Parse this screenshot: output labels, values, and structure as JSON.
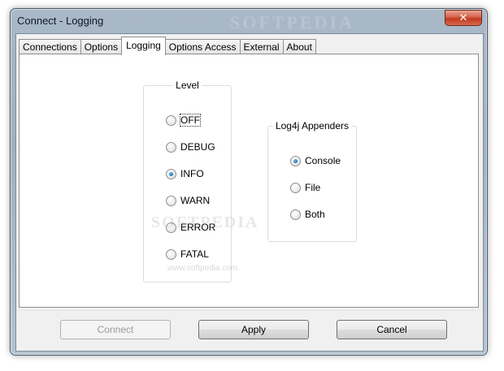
{
  "window": {
    "title": "Connect - Logging",
    "watermark": "SOFTPEDIA",
    "close_glyph": "✕"
  },
  "tabs": [
    {
      "label": "Connections",
      "active": false
    },
    {
      "label": "Options",
      "active": false
    },
    {
      "label": "Logging",
      "active": true
    },
    {
      "label": "Options Access",
      "active": false
    },
    {
      "label": "External",
      "active": false
    },
    {
      "label": "About",
      "active": false
    }
  ],
  "level": {
    "title": "Level",
    "options": [
      {
        "label": "OFF",
        "checked": false
      },
      {
        "label": "DEBUG",
        "checked": false
      },
      {
        "label": "INFO",
        "checked": true
      },
      {
        "label": "WARN",
        "checked": false
      },
      {
        "label": "ERROR",
        "checked": false
      },
      {
        "label": "FATAL",
        "checked": false
      }
    ]
  },
  "appenders": {
    "title": "Log4j Appenders",
    "options": [
      {
        "label": "Console",
        "checked": true
      },
      {
        "label": "File",
        "checked": false
      },
      {
        "label": "Both",
        "checked": false
      }
    ]
  },
  "watermark_center": "SOFTPEDIA",
  "watermark_center_sub": "www.softpedia.com",
  "buttons": {
    "connect": "Connect",
    "apply": "Apply",
    "cancel": "Cancel"
  },
  "colors": {
    "accent": "#1c6fb8",
    "close": "#c2391f"
  }
}
